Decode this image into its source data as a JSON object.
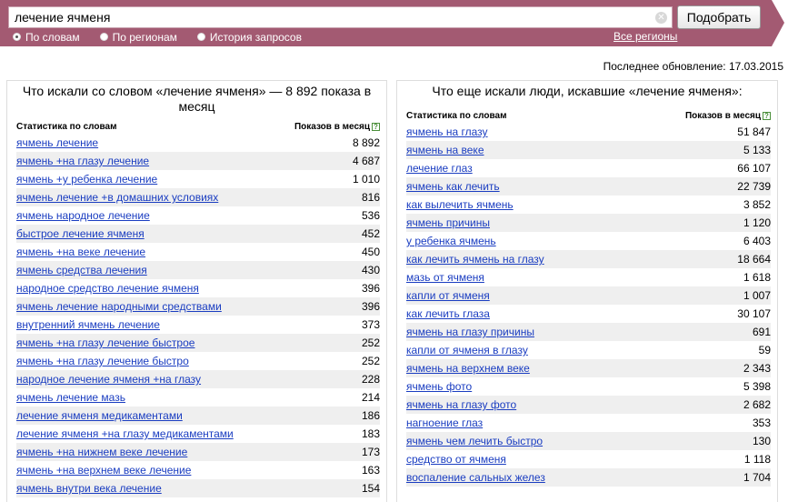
{
  "search": {
    "value": "лечение ячменя",
    "submit_label": "Подобрать",
    "modes": [
      {
        "label": "По словам",
        "selected": true
      },
      {
        "label": "По регионам",
        "selected": false
      },
      {
        "label": "История запросов",
        "selected": false
      }
    ],
    "regions_label": "Все регионы"
  },
  "last_updated": "Последнее обновление: 17.03.2015",
  "left_panel": {
    "title": "Что искали со словом «лечение ячменя» — 8 892 показа в месяц",
    "col_phrase": "Статистика по словам",
    "col_shows": "Показов в месяц",
    "rows": [
      {
        "phrase": "ячмень лечение",
        "count": "8 892"
      },
      {
        "phrase": "ячмень +на глазу лечение",
        "count": "4 687"
      },
      {
        "phrase": "ячмень +у ребенка лечение",
        "count": "1 010"
      },
      {
        "phrase": "ячмень лечение +в домашних условиях",
        "count": "816"
      },
      {
        "phrase": "ячмень народное лечение",
        "count": "536"
      },
      {
        "phrase": "быстрое лечение ячменя",
        "count": "452"
      },
      {
        "phrase": "ячмень +на веке лечение",
        "count": "450"
      },
      {
        "phrase": "ячмень средства лечения",
        "count": "430"
      },
      {
        "phrase": "народное средство лечение ячменя",
        "count": "396"
      },
      {
        "phrase": "ячмень лечение народными средствами",
        "count": "396"
      },
      {
        "phrase": "внутренний ячмень лечение",
        "count": "373"
      },
      {
        "phrase": "ячмень +на глазу лечение быстрое",
        "count": "252"
      },
      {
        "phrase": "ячмень +на глазу лечение быстро",
        "count": "252"
      },
      {
        "phrase": "народное лечение ячменя +на глазу",
        "count": "228"
      },
      {
        "phrase": "ячмень лечение мазь",
        "count": "214"
      },
      {
        "phrase": "лечение ячменя медикаментами",
        "count": "186"
      },
      {
        "phrase": "лечение ячменя +на глазу медикаментами",
        "count": "183"
      },
      {
        "phrase": "ячмень +на нижнем веке лечение",
        "count": "173"
      },
      {
        "phrase": "ячмень +на верхнем веке лечение",
        "count": "163"
      },
      {
        "phrase": "ячмень внутри века лечение",
        "count": "154"
      }
    ]
  },
  "right_panel": {
    "title": "Что еще искали люди, искавшие «лечение ячменя»:",
    "col_phrase": "Статистика по словам",
    "col_shows": "Показов в месяц",
    "rows": [
      {
        "phrase": "ячмень на глазу",
        "count": "51 847"
      },
      {
        "phrase": "ячмень на веке",
        "count": "5 133"
      },
      {
        "phrase": "лечение глаз",
        "count": "66 107"
      },
      {
        "phrase": "ячмень как лечить",
        "count": "22 739"
      },
      {
        "phrase": "как вылечить ячмень",
        "count": "3 852"
      },
      {
        "phrase": "ячмень причины",
        "count": "1 120"
      },
      {
        "phrase": "у ребенка ячмень",
        "count": "6 403"
      },
      {
        "phrase": "как лечить ячмень на глазу",
        "count": "18 664"
      },
      {
        "phrase": "мазь от ячменя",
        "count": "1 618"
      },
      {
        "phrase": "капли от ячменя",
        "count": "1 007"
      },
      {
        "phrase": "как лечить глаза",
        "count": "30 107"
      },
      {
        "phrase": "ячмень на глазу причины",
        "count": "691"
      },
      {
        "phrase": "капли от ячменя в глазу",
        "count": "59"
      },
      {
        "phrase": "ячмень на верхнем веке",
        "count": "2 343"
      },
      {
        "phrase": "ячмень фото",
        "count": "5 398"
      },
      {
        "phrase": "ячмень на глазу фото",
        "count": "2 682"
      },
      {
        "phrase": "нагноение глаз",
        "count": "353"
      },
      {
        "phrase": "ячмень чем лечить быстро",
        "count": "130"
      },
      {
        "phrase": "средство от ячменя",
        "count": "1 118"
      },
      {
        "phrase": "воспаление сальных желез",
        "count": "1 704"
      }
    ]
  },
  "colors": {
    "topbar": "#a35a72",
    "link": "#1a3dc1",
    "row_alt": "#efefef"
  },
  "icons": {
    "clear": "clear-icon",
    "help": "help-icon"
  }
}
